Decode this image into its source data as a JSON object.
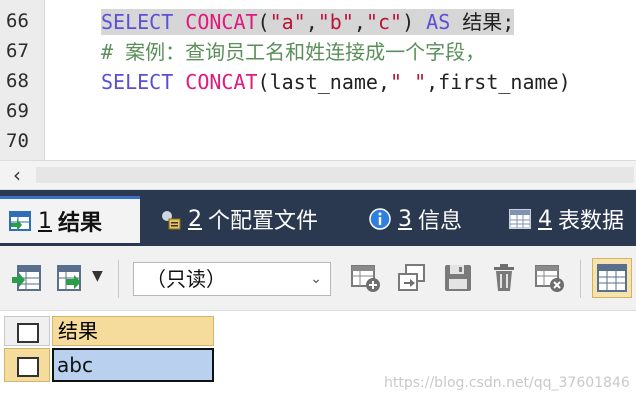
{
  "editor": {
    "lines": [
      {
        "number": "66",
        "tokens": [
          {
            "t": "SELECT ",
            "c": "kw"
          },
          {
            "t": "CONCAT",
            "c": "fn"
          },
          {
            "t": "(",
            "c": "txt"
          },
          {
            "t": "\"a\"",
            "c": "str"
          },
          {
            "t": ",",
            "c": "txt"
          },
          {
            "t": "\"b\"",
            "c": "str"
          },
          {
            "t": ",",
            "c": "txt"
          },
          {
            "t": "\"c\"",
            "c": "str"
          },
          {
            "t": ") ",
            "c": "txt"
          },
          {
            "t": "AS ",
            "c": "kw"
          },
          {
            "t": "结果;",
            "c": "txt"
          }
        ]
      },
      {
        "number": "67",
        "tokens": [
          {
            "t": "# 案例：查询员工名和姓连接成一个字段，",
            "c": "cm"
          }
        ]
      },
      {
        "number": "68",
        "tokens": [
          {
            "t": "SELECT ",
            "c": "kw"
          },
          {
            "t": "CONCAT",
            "c": "fn"
          },
          {
            "t": "(last_name,",
            "c": "txt"
          },
          {
            "t": "\" \"",
            "c": "str"
          },
          {
            "t": ",first_name)",
            "c": "txt"
          }
        ]
      },
      {
        "number": "69",
        "tokens": []
      },
      {
        "number": "70",
        "tokens": []
      }
    ]
  },
  "tabs": [
    {
      "num": "1",
      "label": "结果",
      "icon": "result-table-icon"
    },
    {
      "num": "2",
      "label": "个配置文件",
      "icon": "profile-icon"
    },
    {
      "num": "3",
      "label": "信息",
      "icon": "info-icon"
    },
    {
      "num": "4",
      "label": "表数据",
      "icon": "table-data-icon"
    }
  ],
  "toolbar": {
    "readonly_label": "（只读）"
  },
  "grid": {
    "header": "结果",
    "rows": [
      {
        "value": "abc"
      }
    ]
  },
  "watermark": "https://blog.csdn.net/qq_37601846",
  "colors": {
    "tabbar_bg": "#2b3950",
    "keyword": "#5b4fd6",
    "function": "#e0197d",
    "string": "#b8153b",
    "comment": "#5a8f5a",
    "selected_cell": "#b9d1ee",
    "header_bg": "#f6dc9c"
  }
}
